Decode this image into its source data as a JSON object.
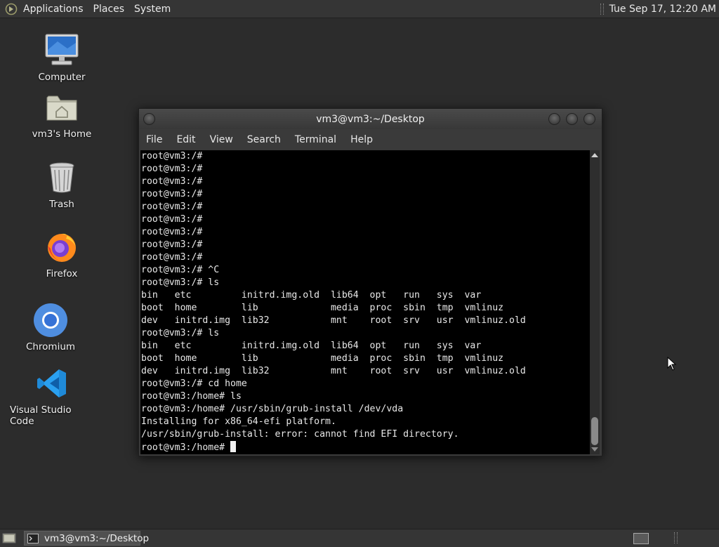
{
  "top_panel": {
    "menus": [
      "Applications",
      "Places",
      "System"
    ],
    "clock": "Tue Sep 17, 12:20 AM"
  },
  "desktop_icons": [
    {
      "label": "Computer",
      "icon": "computer-icon"
    },
    {
      "label": "vm3's Home",
      "icon": "home-folder-icon"
    },
    {
      "label": "Trash",
      "icon": "trash-icon"
    },
    {
      "label": "Firefox",
      "icon": "firefox-icon"
    },
    {
      "label": "Chromium",
      "icon": "chromium-icon"
    },
    {
      "label": "Visual Studio Code",
      "icon": "vscode-icon"
    }
  ],
  "terminal": {
    "title": "vm3@vm3:~/Desktop",
    "menu": [
      "File",
      "Edit",
      "View",
      "Search",
      "Terminal",
      "Help"
    ],
    "lines": [
      "root@vm3:/#",
      "root@vm3:/#",
      "root@vm3:/#",
      "root@vm3:/#",
      "root@vm3:/#",
      "root@vm3:/#",
      "root@vm3:/#",
      "root@vm3:/#",
      "root@vm3:/#",
      "root@vm3:/# ^C",
      "root@vm3:/# ls",
      "bin   etc         initrd.img.old  lib64  opt   run   sys  var",
      "boot  home        lib             media  proc  sbin  tmp  vmlinuz",
      "dev   initrd.img  lib32           mnt    root  srv   usr  vmlinuz.old",
      "root@vm3:/# ls",
      "bin   etc         initrd.img.old  lib64  opt   run   sys  var",
      "boot  home        lib             media  proc  sbin  tmp  vmlinuz",
      "dev   initrd.img  lib32           mnt    root  srv   usr  vmlinuz.old",
      "root@vm3:/# cd home",
      "root@vm3:/home# ls",
      "root@vm3:/home# /usr/sbin/grub-install /dev/vda",
      "Installing for x86_64-efi platform.",
      "/usr/sbin/grub-install: error: cannot find EFI directory."
    ],
    "prompt": "root@vm3:/home# "
  },
  "bottom_panel": {
    "task_label": "vm3@vm3:~/Desktop"
  }
}
